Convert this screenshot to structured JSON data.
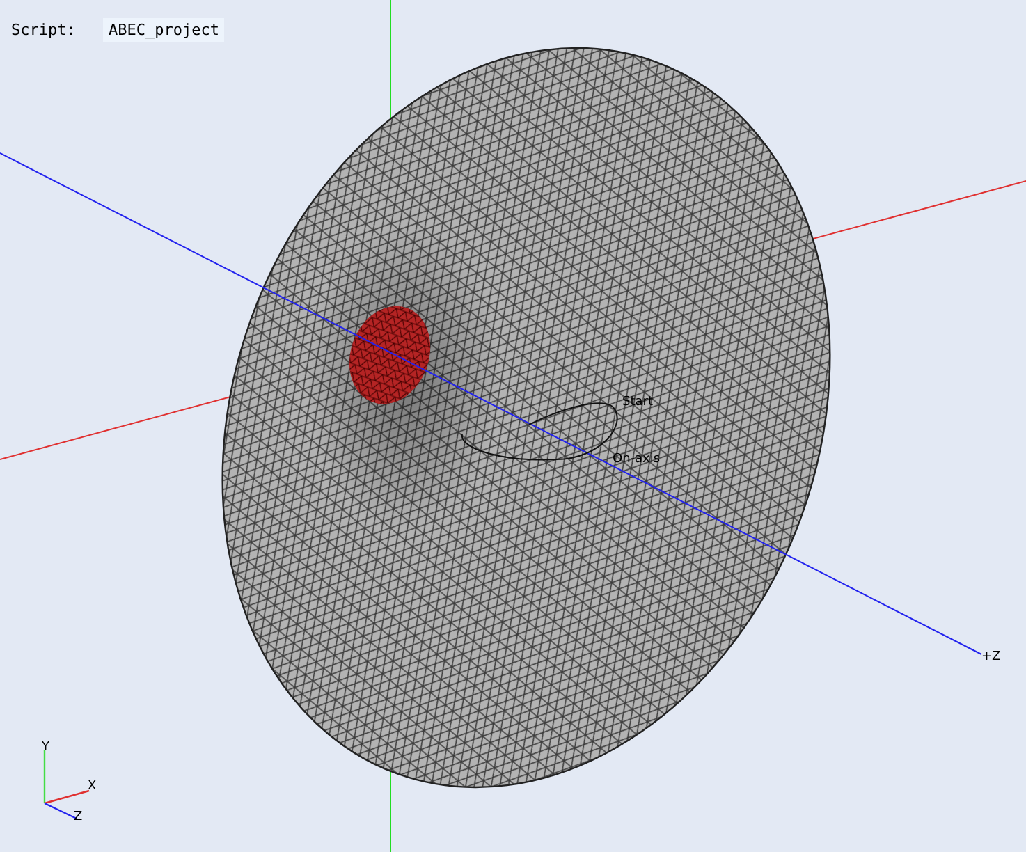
{
  "script_bar": {
    "label": "Script:",
    "value": "ABEC_project"
  },
  "viewport": {
    "labels": [
      {
        "text": "Start"
      },
      {
        "text": "On-axis"
      },
      {
        "text": "+Z"
      }
    ]
  },
  "axis_triad": {
    "labels": [
      "Y",
      "X",
      "Z"
    ]
  }
}
